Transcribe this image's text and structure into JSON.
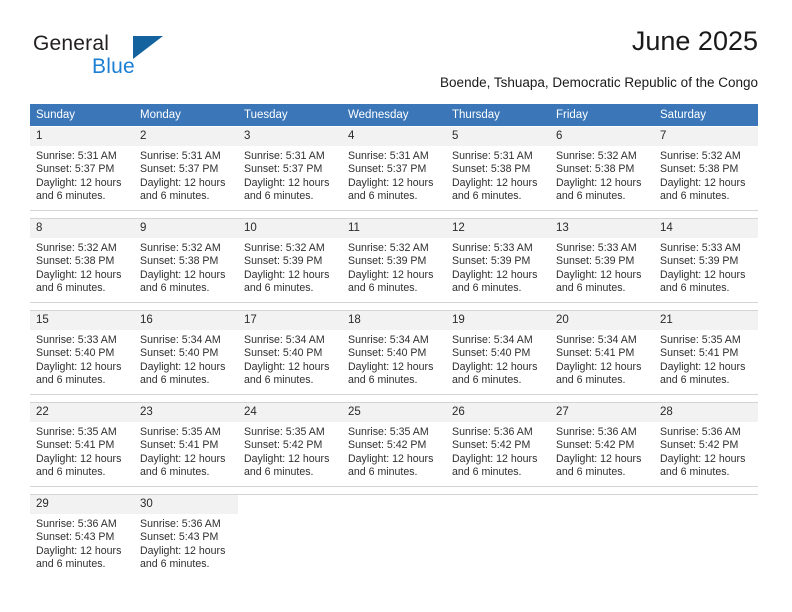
{
  "brand": {
    "name_top": "General",
    "name_bottom": "Blue",
    "triangle_color": "#15639e",
    "blue_color": "#1b7fd4"
  },
  "header": {
    "title": "June 2025",
    "location": "Boende, Tshuapa, Democratic Republic of the Congo"
  },
  "theme": {
    "header_blue": "#3a76b8",
    "daynum_gray": "#f2f2f2",
    "separator_gray": "#d4d4d4"
  },
  "weekday_headers": [
    "Sunday",
    "Monday",
    "Tuesday",
    "Wednesday",
    "Thursday",
    "Friday",
    "Saturday"
  ],
  "labels": {
    "sunrise_prefix": "Sunrise:",
    "sunset_prefix": "Sunset:",
    "daylight_prefix": "Daylight:"
  },
  "weeks": [
    [
      {
        "day": "1",
        "sunrise": "Sunrise: 5:31 AM",
        "sunset": "Sunset: 5:37 PM",
        "daylight1": "Daylight: 12 hours",
        "daylight2": "and 6 minutes."
      },
      {
        "day": "2",
        "sunrise": "Sunrise: 5:31 AM",
        "sunset": "Sunset: 5:37 PM",
        "daylight1": "Daylight: 12 hours",
        "daylight2": "and 6 minutes."
      },
      {
        "day": "3",
        "sunrise": "Sunrise: 5:31 AM",
        "sunset": "Sunset: 5:37 PM",
        "daylight1": "Daylight: 12 hours",
        "daylight2": "and 6 minutes."
      },
      {
        "day": "4",
        "sunrise": "Sunrise: 5:31 AM",
        "sunset": "Sunset: 5:37 PM",
        "daylight1": "Daylight: 12 hours",
        "daylight2": "and 6 minutes."
      },
      {
        "day": "5",
        "sunrise": "Sunrise: 5:31 AM",
        "sunset": "Sunset: 5:38 PM",
        "daylight1": "Daylight: 12 hours",
        "daylight2": "and 6 minutes."
      },
      {
        "day": "6",
        "sunrise": "Sunrise: 5:32 AM",
        "sunset": "Sunset: 5:38 PM",
        "daylight1": "Daylight: 12 hours",
        "daylight2": "and 6 minutes."
      },
      {
        "day": "7",
        "sunrise": "Sunrise: 5:32 AM",
        "sunset": "Sunset: 5:38 PM",
        "daylight1": "Daylight: 12 hours",
        "daylight2": "and 6 minutes."
      }
    ],
    [
      {
        "day": "8",
        "sunrise": "Sunrise: 5:32 AM",
        "sunset": "Sunset: 5:38 PM",
        "daylight1": "Daylight: 12 hours",
        "daylight2": "and 6 minutes."
      },
      {
        "day": "9",
        "sunrise": "Sunrise: 5:32 AM",
        "sunset": "Sunset: 5:38 PM",
        "daylight1": "Daylight: 12 hours",
        "daylight2": "and 6 minutes."
      },
      {
        "day": "10",
        "sunrise": "Sunrise: 5:32 AM",
        "sunset": "Sunset: 5:39 PM",
        "daylight1": "Daylight: 12 hours",
        "daylight2": "and 6 minutes."
      },
      {
        "day": "11",
        "sunrise": "Sunrise: 5:32 AM",
        "sunset": "Sunset: 5:39 PM",
        "daylight1": "Daylight: 12 hours",
        "daylight2": "and 6 minutes."
      },
      {
        "day": "12",
        "sunrise": "Sunrise: 5:33 AM",
        "sunset": "Sunset: 5:39 PM",
        "daylight1": "Daylight: 12 hours",
        "daylight2": "and 6 minutes."
      },
      {
        "day": "13",
        "sunrise": "Sunrise: 5:33 AM",
        "sunset": "Sunset: 5:39 PM",
        "daylight1": "Daylight: 12 hours",
        "daylight2": "and 6 minutes."
      },
      {
        "day": "14",
        "sunrise": "Sunrise: 5:33 AM",
        "sunset": "Sunset: 5:39 PM",
        "daylight1": "Daylight: 12 hours",
        "daylight2": "and 6 minutes."
      }
    ],
    [
      {
        "day": "15",
        "sunrise": "Sunrise: 5:33 AM",
        "sunset": "Sunset: 5:40 PM",
        "daylight1": "Daylight: 12 hours",
        "daylight2": "and 6 minutes."
      },
      {
        "day": "16",
        "sunrise": "Sunrise: 5:34 AM",
        "sunset": "Sunset: 5:40 PM",
        "daylight1": "Daylight: 12 hours",
        "daylight2": "and 6 minutes."
      },
      {
        "day": "17",
        "sunrise": "Sunrise: 5:34 AM",
        "sunset": "Sunset: 5:40 PM",
        "daylight1": "Daylight: 12 hours",
        "daylight2": "and 6 minutes."
      },
      {
        "day": "18",
        "sunrise": "Sunrise: 5:34 AM",
        "sunset": "Sunset: 5:40 PM",
        "daylight1": "Daylight: 12 hours",
        "daylight2": "and 6 minutes."
      },
      {
        "day": "19",
        "sunrise": "Sunrise: 5:34 AM",
        "sunset": "Sunset: 5:40 PM",
        "daylight1": "Daylight: 12 hours",
        "daylight2": "and 6 minutes."
      },
      {
        "day": "20",
        "sunrise": "Sunrise: 5:34 AM",
        "sunset": "Sunset: 5:41 PM",
        "daylight1": "Daylight: 12 hours",
        "daylight2": "and 6 minutes."
      },
      {
        "day": "21",
        "sunrise": "Sunrise: 5:35 AM",
        "sunset": "Sunset: 5:41 PM",
        "daylight1": "Daylight: 12 hours",
        "daylight2": "and 6 minutes."
      }
    ],
    [
      {
        "day": "22",
        "sunrise": "Sunrise: 5:35 AM",
        "sunset": "Sunset: 5:41 PM",
        "daylight1": "Daylight: 12 hours",
        "daylight2": "and 6 minutes."
      },
      {
        "day": "23",
        "sunrise": "Sunrise: 5:35 AM",
        "sunset": "Sunset: 5:41 PM",
        "daylight1": "Daylight: 12 hours",
        "daylight2": "and 6 minutes."
      },
      {
        "day": "24",
        "sunrise": "Sunrise: 5:35 AM",
        "sunset": "Sunset: 5:42 PM",
        "daylight1": "Daylight: 12 hours",
        "daylight2": "and 6 minutes."
      },
      {
        "day": "25",
        "sunrise": "Sunrise: 5:35 AM",
        "sunset": "Sunset: 5:42 PM",
        "daylight1": "Daylight: 12 hours",
        "daylight2": "and 6 minutes."
      },
      {
        "day": "26",
        "sunrise": "Sunrise: 5:36 AM",
        "sunset": "Sunset: 5:42 PM",
        "daylight1": "Daylight: 12 hours",
        "daylight2": "and 6 minutes."
      },
      {
        "day": "27",
        "sunrise": "Sunrise: 5:36 AM",
        "sunset": "Sunset: 5:42 PM",
        "daylight1": "Daylight: 12 hours",
        "daylight2": "and 6 minutes."
      },
      {
        "day": "28",
        "sunrise": "Sunrise: 5:36 AM",
        "sunset": "Sunset: 5:42 PM",
        "daylight1": "Daylight: 12 hours",
        "daylight2": "and 6 minutes."
      }
    ],
    [
      {
        "day": "29",
        "sunrise": "Sunrise: 5:36 AM",
        "sunset": "Sunset: 5:43 PM",
        "daylight1": "Daylight: 12 hours",
        "daylight2": "and 6 minutes."
      },
      {
        "day": "30",
        "sunrise": "Sunrise: 5:36 AM",
        "sunset": "Sunset: 5:43 PM",
        "daylight1": "Daylight: 12 hours",
        "daylight2": "and 6 minutes."
      },
      {
        "day": "",
        "sunrise": "",
        "sunset": "",
        "daylight1": "",
        "daylight2": ""
      },
      {
        "day": "",
        "sunrise": "",
        "sunset": "",
        "daylight1": "",
        "daylight2": ""
      },
      {
        "day": "",
        "sunrise": "",
        "sunset": "",
        "daylight1": "",
        "daylight2": ""
      },
      {
        "day": "",
        "sunrise": "",
        "sunset": "",
        "daylight1": "",
        "daylight2": ""
      },
      {
        "day": "",
        "sunrise": "",
        "sunset": "",
        "daylight1": "",
        "daylight2": ""
      }
    ]
  ]
}
